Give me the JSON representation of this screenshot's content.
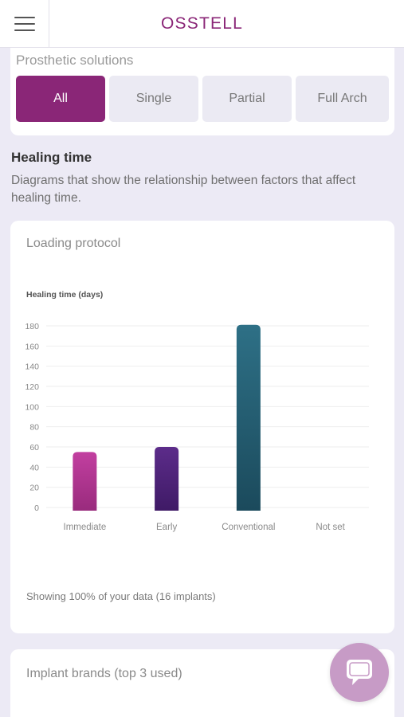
{
  "header": {
    "menu_icon": "hamburger-menu-icon",
    "brand": "OSSTELL"
  },
  "prosthetic": {
    "label": "Prosthetic solutions",
    "filters": [
      {
        "label": "All",
        "active": true
      },
      {
        "label": "Single",
        "active": false
      },
      {
        "label": "Partial",
        "active": false
      },
      {
        "label": "Full Arch",
        "active": false
      }
    ]
  },
  "healing": {
    "title": "Healing time",
    "description": "Diagrams that show the relationship between factors that affect healing time."
  },
  "loading_card": {
    "title": "Loading protocol",
    "footnote": "Showing 100% of your data (16 implants)"
  },
  "brands_card": {
    "title": "Implant brands (top 3 used)"
  },
  "chat": {
    "icon": "chat-bubble-icon"
  },
  "colors": {
    "accent": "#8a2677",
    "active_filter": "#8a2677"
  },
  "chart_data": {
    "type": "bar",
    "title": "Loading protocol",
    "ylabel": "Healing time (days)",
    "xlabel": "",
    "categories": [
      "Immediate",
      "Early",
      "Conventional",
      "Not set"
    ],
    "values": [
      55,
      60,
      181,
      0
    ],
    "ylim": [
      0,
      180
    ],
    "yticks": [
      0,
      20,
      40,
      60,
      80,
      100,
      120,
      140,
      160,
      180
    ],
    "grid": true,
    "colors": [
      [
        "#c23fa0",
        "#992b7d"
      ],
      [
        "#5c2c8a",
        "#3f1a66"
      ],
      [
        "#2e7086",
        "#1b4a5c"
      ],
      [
        "#cccccc",
        "#cccccc"
      ]
    ]
  }
}
